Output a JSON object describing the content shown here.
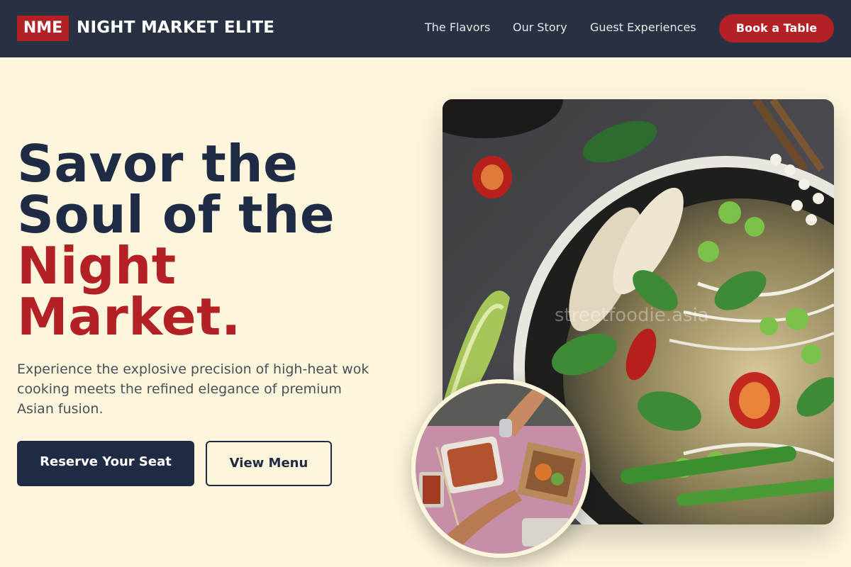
{
  "navbar": {
    "logo_text": "NME",
    "brand_name": "NIGHT MARKET ELITE",
    "links": [
      "The Flavors",
      "Our Story",
      "Guest Experiences"
    ],
    "book_button": "Book a Table"
  },
  "hero": {
    "headline_lines": [
      "Savor the",
      "Soul of the",
      "Night",
      "Market."
    ],
    "tagline": "Experience the explosive precision of high-heat wok cooking meets the refined elegance of premium Asian fusion.",
    "primary_button": "Reserve Your Seat",
    "secondary_button": "View Menu",
    "image_watermark": "streetfoodie.asia"
  },
  "colors": {
    "navbar_bg": "#273142",
    "accent": "#b32126",
    "heading": "#1f2a44",
    "page_bg": "#fdf6dc"
  },
  "images": {
    "main": "noodle-soup-bowl-photo",
    "inset": "street-food-sharing-photo"
  }
}
